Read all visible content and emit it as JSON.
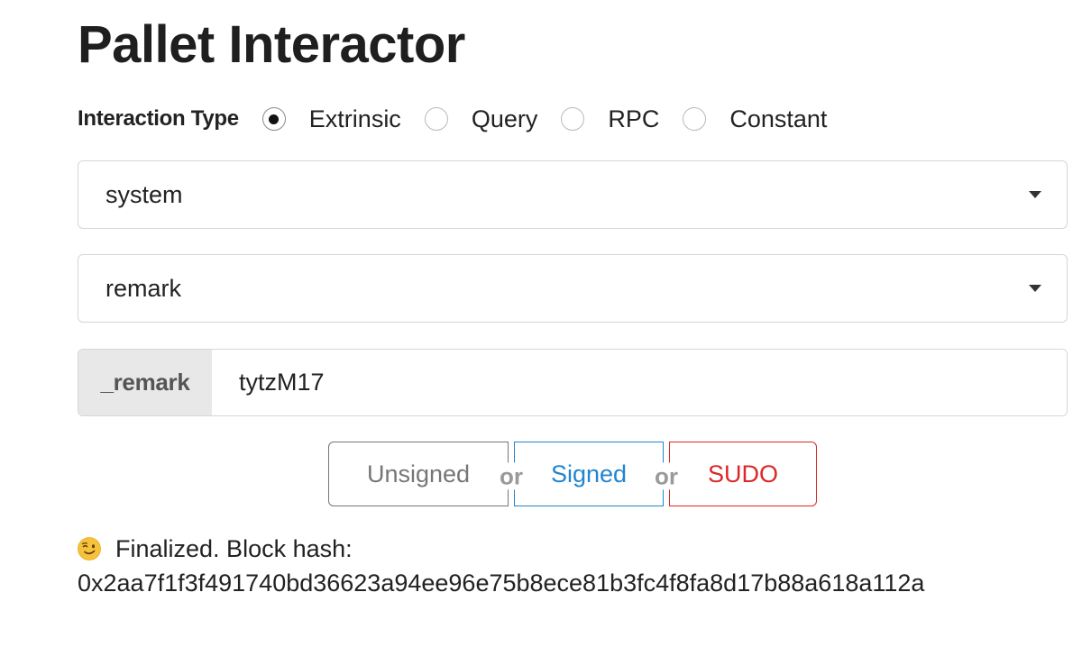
{
  "title": "Pallet Interactor",
  "interaction": {
    "label": "Interaction Type",
    "options": [
      {
        "label": "Extrinsic",
        "checked": true
      },
      {
        "label": "Query",
        "checked": false
      },
      {
        "label": "RPC",
        "checked": false
      },
      {
        "label": "Constant",
        "checked": false
      }
    ]
  },
  "pallet_select": {
    "value": "system",
    "icon": "caret-down-icon"
  },
  "callable_select": {
    "value": "remark",
    "icon": "caret-down-icon"
  },
  "param": {
    "label": "_remark",
    "value": "tytzM17"
  },
  "buttons": {
    "unsigned": "Unsigned",
    "or1": "or",
    "signed": "Signed",
    "or2": "or",
    "sudo": "SUDO"
  },
  "status": {
    "icon": "winking-face-icon",
    "text": "Finalized. Block hash:",
    "hash": "0x2aa7f1f3f491740bd36623a94ee96e75b8ece81b3fc4f8fa8d17b88a618a112a"
  },
  "colors": {
    "signed": "#2185d0",
    "sudo": "#db2828",
    "unsigned": "#767676"
  }
}
